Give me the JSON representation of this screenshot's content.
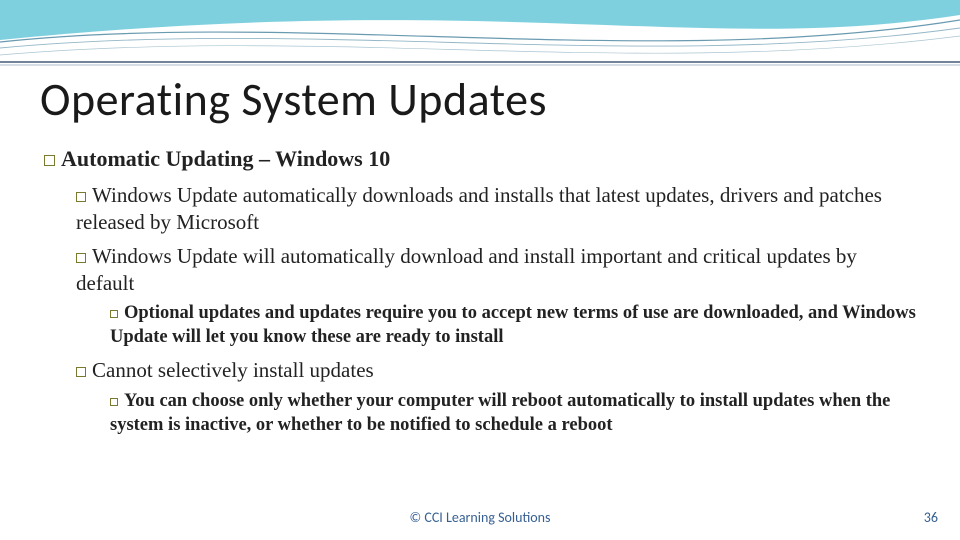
{
  "title": "Operating System Updates",
  "bullets": {
    "h1": "Automatic Updating – Windows 10",
    "b1": "Windows Update automatically downloads and installs that latest updates, drivers and patches released by Microsoft",
    "b2": "Windows Update will automatically download and install important and critical updates by default",
    "b2a": "Optional updates and updates require you to accept new terms of use are downloaded, and Windows Update will let you know these are ready to install",
    "b3": "Cannot selectively install updates",
    "b3a": "You can choose only whether your computer will reboot automatically to install updates when the system is inactive, or whether to be notified to schedule a reboot"
  },
  "footer": {
    "copyright": "© CCI Learning Solutions",
    "page": "36"
  }
}
